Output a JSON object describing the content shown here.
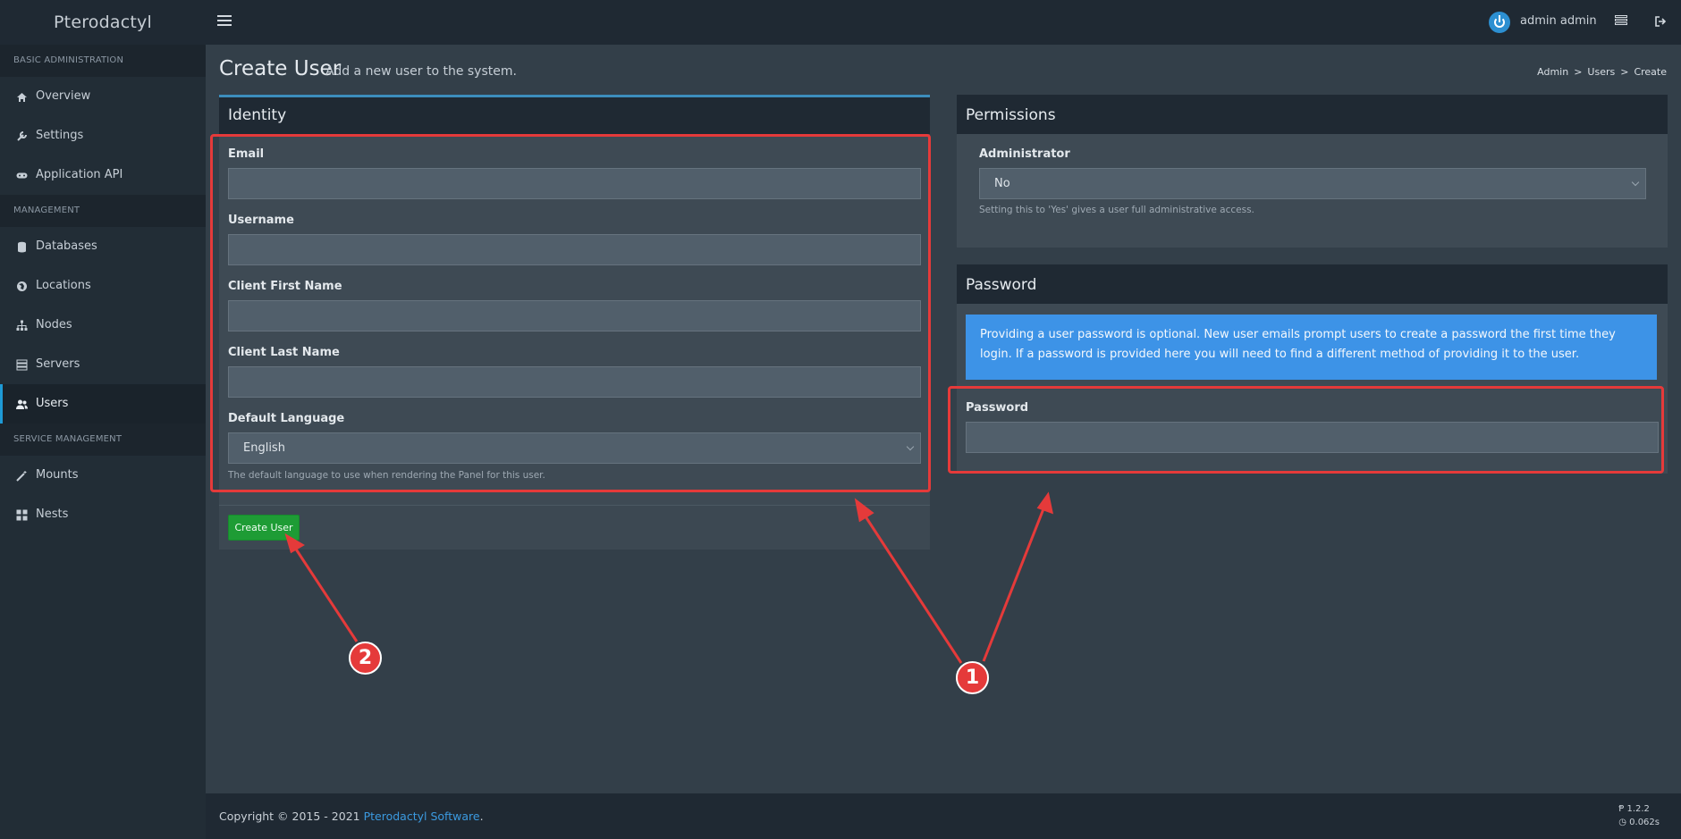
{
  "app": {
    "brand": "Pterodactyl"
  },
  "topbar": {
    "user_name": "admin admin"
  },
  "sidebar": {
    "sections": [
      {
        "header": "BASIC ADMINISTRATION",
        "items": [
          {
            "label": "Overview",
            "icon": "home-icon"
          },
          {
            "label": "Settings",
            "icon": "wrench-icon"
          },
          {
            "label": "Application API",
            "icon": "gamepad-icon"
          }
        ]
      },
      {
        "header": "MANAGEMENT",
        "items": [
          {
            "label": "Databases",
            "icon": "database-icon"
          },
          {
            "label": "Locations",
            "icon": "globe-icon"
          },
          {
            "label": "Nodes",
            "icon": "sitemap-icon"
          },
          {
            "label": "Servers",
            "icon": "server-icon"
          },
          {
            "label": "Users",
            "icon": "users-icon",
            "active": true
          }
        ]
      },
      {
        "header": "SERVICE MANAGEMENT",
        "items": [
          {
            "label": "Mounts",
            "icon": "magic-icon"
          },
          {
            "label": "Nests",
            "icon": "th-large-icon"
          }
        ]
      }
    ]
  },
  "page": {
    "title": "Create User",
    "subtitle": "Add a new user to the system.",
    "breadcrumb": [
      "Admin",
      "Users",
      "Create"
    ],
    "breadcrumb_sep": ">"
  },
  "identity": {
    "title": "Identity",
    "fields": {
      "email": {
        "label": "Email",
        "value": ""
      },
      "username": {
        "label": "Username",
        "value": ""
      },
      "first_name": {
        "label": "Client First Name",
        "value": ""
      },
      "last_name": {
        "label": "Client Last Name",
        "value": ""
      },
      "language": {
        "label": "Default Language",
        "value": "English",
        "help": "The default language to use when rendering the Panel for this user."
      }
    },
    "submit": "Create User"
  },
  "permissions": {
    "title": "Permissions",
    "admin_label": "Administrator",
    "admin_value": "No",
    "admin_help": "Setting this to 'Yes' gives a user full administrative access."
  },
  "password": {
    "title": "Password",
    "info": "Providing a user password is optional. New user emails prompt users to create a password the first time they login. If a password is provided here you will need to find a different method of providing it to the user.",
    "field_label": "Password",
    "value": ""
  },
  "footer": {
    "copyright": "Copyright © 2015 - 2021",
    "link": "Pterodactyl Software",
    "end": ".",
    "version": "1.2.2",
    "time": "0.062s"
  },
  "annotations": {
    "badge_1": "1",
    "badge_2": "2",
    "color": "#e53a3a"
  }
}
